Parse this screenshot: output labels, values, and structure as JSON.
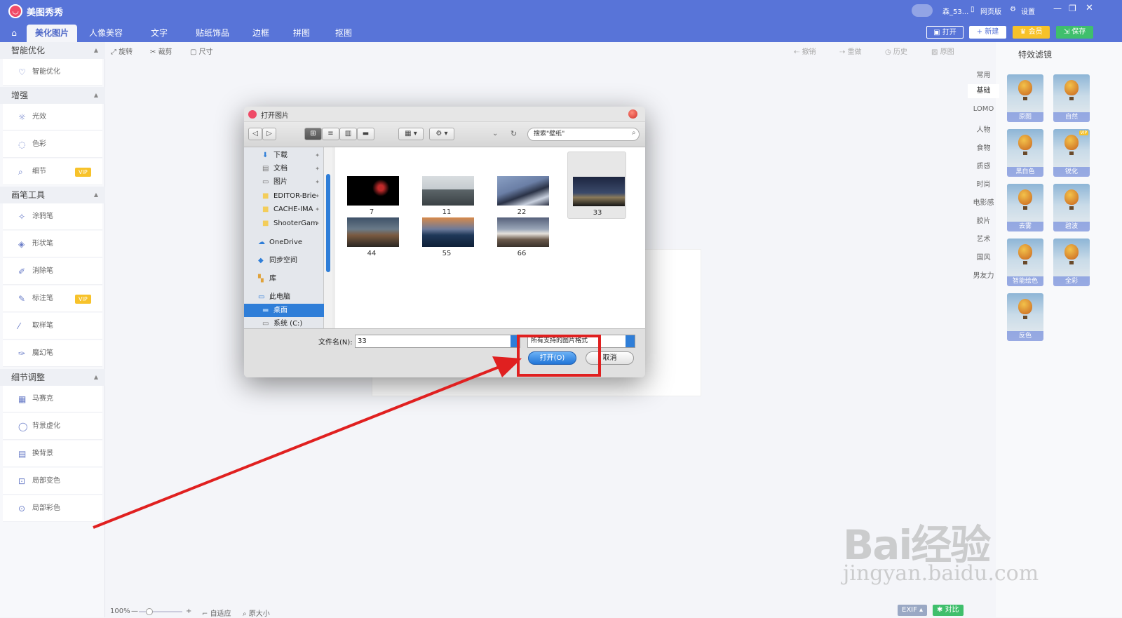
{
  "app": {
    "title": "美图秀秀",
    "user_name": "森_53...",
    "web_link": "网页版",
    "settings_link": "设置"
  },
  "tabs": [
    "美化图片",
    "人像美容",
    "文字",
    "贴纸饰品",
    "边框",
    "拼图",
    "抠图"
  ],
  "top_actions": {
    "open": "打开",
    "new": "新建",
    "member": "会员",
    "save": "保存"
  },
  "toolbar": {
    "rotate": "旋转",
    "crop": "裁剪",
    "size": "尺寸",
    "undo": "撤销",
    "redo": "重做",
    "history": "历史",
    "original": "原图"
  },
  "left_panel": {
    "sections": [
      {
        "title": "智能优化",
        "items": [
          {
            "label": "智能优化"
          }
        ]
      },
      {
        "title": "增强",
        "items": [
          {
            "label": "光效"
          },
          {
            "label": "色彩"
          },
          {
            "label": "细节",
            "badge": "VIP"
          }
        ]
      },
      {
        "title": "画笔工具",
        "items": [
          {
            "label": "涂鸦笔"
          },
          {
            "label": "形状笔"
          },
          {
            "label": "消除笔"
          },
          {
            "label": "标注笔",
            "badge": "VIP"
          },
          {
            "label": "取样笔"
          },
          {
            "label": "魔幻笔"
          }
        ]
      },
      {
        "title": "细节调整",
        "items": [
          {
            "label": "马赛克"
          },
          {
            "label": "背景虚化"
          },
          {
            "label": "换背景"
          },
          {
            "label": "局部变色"
          },
          {
            "label": "局部彩色"
          }
        ]
      }
    ]
  },
  "right_panel": {
    "title": "特效滤镜",
    "categories": [
      "常用",
      "基础",
      "LOMO",
      "人物",
      "食物",
      "质感",
      "时尚",
      "电影感",
      "胶片",
      "艺术",
      "国风",
      "男友力"
    ],
    "active_category": "基础",
    "filters": [
      {
        "label": "原图"
      },
      {
        "label": "自然"
      },
      {
        "label": "黑白色"
      },
      {
        "label": "锐化",
        "badge": "VIP"
      },
      {
        "label": "去雾"
      },
      {
        "label": "碧波"
      },
      {
        "label": "智能绘色"
      },
      {
        "label": "全彩"
      },
      {
        "label": "反色"
      }
    ]
  },
  "dialog": {
    "title": "打开图片",
    "search_placeholder": "搜索\"壁纸\"",
    "sidebar": [
      {
        "label": "下载",
        "icon": "download-icon"
      },
      {
        "label": "文档",
        "icon": "document-icon"
      },
      {
        "label": "图片",
        "icon": "picture-icon"
      },
      {
        "label": "EDITOR-Brie",
        "icon": "folder-icon"
      },
      {
        "label": "CACHE-IMA",
        "icon": "folder-icon"
      },
      {
        "label": "ShooterGam",
        "icon": "folder-icon"
      },
      {
        "label": "OneDrive",
        "icon": "cloud-icon"
      },
      {
        "label": "同步空间",
        "icon": "sync-icon"
      },
      {
        "label": "库",
        "icon": "library-icon"
      },
      {
        "label": "此电脑",
        "icon": "computer-icon"
      },
      {
        "label": "桌面",
        "icon": "desktop-icon"
      },
      {
        "label": "系统 (C:)",
        "icon": "drive-icon"
      }
    ],
    "selected_sidebar": "桌面",
    "files": [
      {
        "name": "7"
      },
      {
        "name": "11"
      },
      {
        "name": "22"
      },
      {
        "name": "33"
      },
      {
        "name": "44"
      },
      {
        "name": "55"
      },
      {
        "name": "66"
      }
    ],
    "selected_file": "33",
    "filename_label": "文件名(N):",
    "filename_value": "33",
    "filetype": "所有支持的图片格式",
    "open_button": "打开(O)",
    "cancel_button": "取消"
  },
  "status_bar": {
    "zoom": "100%",
    "fit": "自适应",
    "actual_size": "原大小",
    "exif": "EXIF",
    "compare": "对比"
  },
  "watermark": {
    "brand": "Bai经验",
    "url": "jingyan.baidu.com"
  },
  "colors": {
    "brand": "#5874d8",
    "accent_red": "#e02020",
    "vip": "#f7c22a",
    "save_green": "#3fbf6c",
    "select_blue": "#2f7ed8"
  }
}
